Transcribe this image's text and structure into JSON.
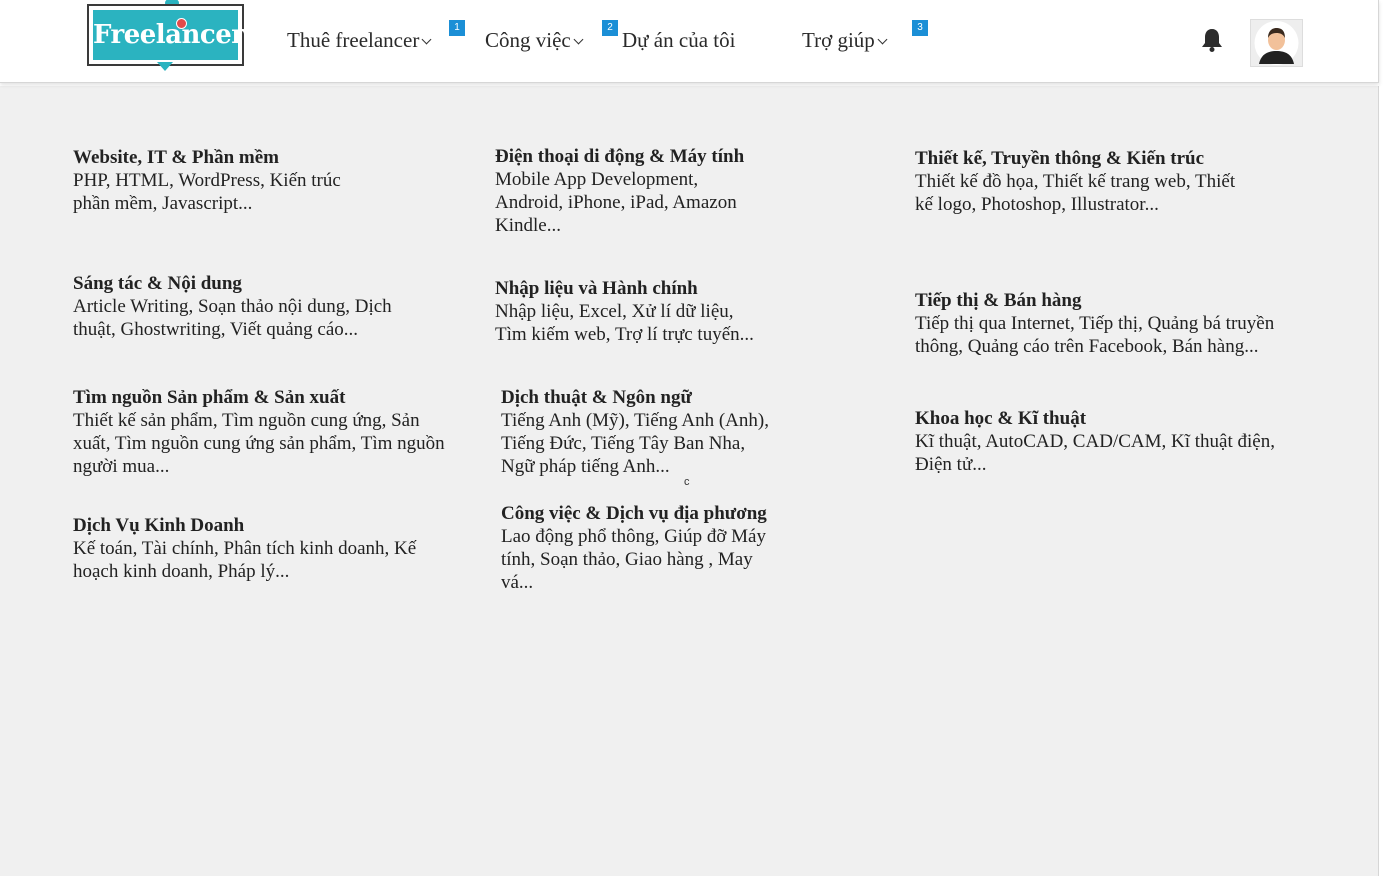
{
  "brand": {
    "logo_text": "Freelancer",
    "colors": {
      "teal": "#2bb3c0",
      "badge_blue": "#1b8fd6",
      "page_bg": "#f0f0f0"
    }
  },
  "nav": {
    "items": [
      {
        "label": "Thuê freelancer",
        "has_dropdown": true,
        "badge": "1"
      },
      {
        "label": "Công việc",
        "has_dropdown": true,
        "badge": "2"
      },
      {
        "label": "Dự án của tôi",
        "has_dropdown": false,
        "badge": ""
      },
      {
        "label": "Trợ giúp",
        "has_dropdown": true,
        "badge": "3"
      }
    ]
  },
  "header_icons": {
    "notification": "bell-icon",
    "profile": "avatar"
  },
  "categories": [
    {
      "title": "Website, IT & Phần mềm",
      "desc_lines": [
        "PHP, HTML, WordPress, Kiến trúc",
        "phần mềm, Javascript..."
      ]
    },
    {
      "title": "Điện thoại di động & Máy tính",
      "desc_lines": [
        "Mobile App Development,",
        "Android, iPhone, iPad, Amazon",
        "Kindle..."
      ]
    },
    {
      "title": "Thiết kế, Truyền thông & Kiến trúc",
      "desc_lines": [
        "Thiết kế đồ họa, Thiết kế trang web, Thiết",
        "kế logo, Photoshop, Illustrator..."
      ]
    },
    {
      "title": "Sáng tác & Nội dung",
      "desc_lines": [
        "Article Writing, Soạn thảo nội dung, Dịch",
        "thuật, Ghostwriting, Viết quảng cáo..."
      ]
    },
    {
      "title": "Nhập liệu và Hành chính",
      "desc_lines": [
        "Nhập liệu, Excel, Xử lí dữ liệu,",
        "Tìm kiếm web, Trợ lí trực tuyến..."
      ]
    },
    {
      "title": "Tiếp thị & Bán hàng",
      "desc_lines": [
        "Tiếp thị qua Internet, Tiếp thị, Quảng bá truyền",
        "thông, Quảng cáo trên Facebook, Bán hàng..."
      ]
    },
    {
      "title": "Tìm nguồn Sản phẩm & Sản xuất",
      "desc_lines": [
        "Thiết kế sản phẩm, Tìm nguồn cung ứng, Sản",
        "xuất, Tìm nguồn cung ứng sản phẩm, Tìm nguồn",
        "người mua..."
      ]
    },
    {
      "title": "Dịch thuật & Ngôn ngữ",
      "desc_lines": [
        "Tiếng Anh (Mỹ), Tiếng Anh (Anh),",
        "Tiếng Đức, Tiếng Tây Ban Nha,",
        "Ngữ pháp tiếng Anh..."
      ]
    },
    {
      "title": "Khoa học & Kĩ thuật",
      "desc_lines": [
        "Kĩ thuật, AutoCAD, CAD/CAM, Kĩ thuật điện,",
        "Điện tử..."
      ]
    },
    {
      "title": "Dịch Vụ Kinh Doanh",
      "desc_lines": [
        "Kế toán, Tài chính, Phân tích kinh doanh, Kế",
        "hoạch kinh doanh, Pháp lý..."
      ]
    },
    {
      "title": "Công việc & Dịch vụ địa phương",
      "desc_lines": [
        "Lao động phổ thông, Giúp đỡ Máy",
        "tính, Soạn thảo, Giao hàng , May",
        "vá..."
      ]
    }
  ],
  "stray_char": "c"
}
